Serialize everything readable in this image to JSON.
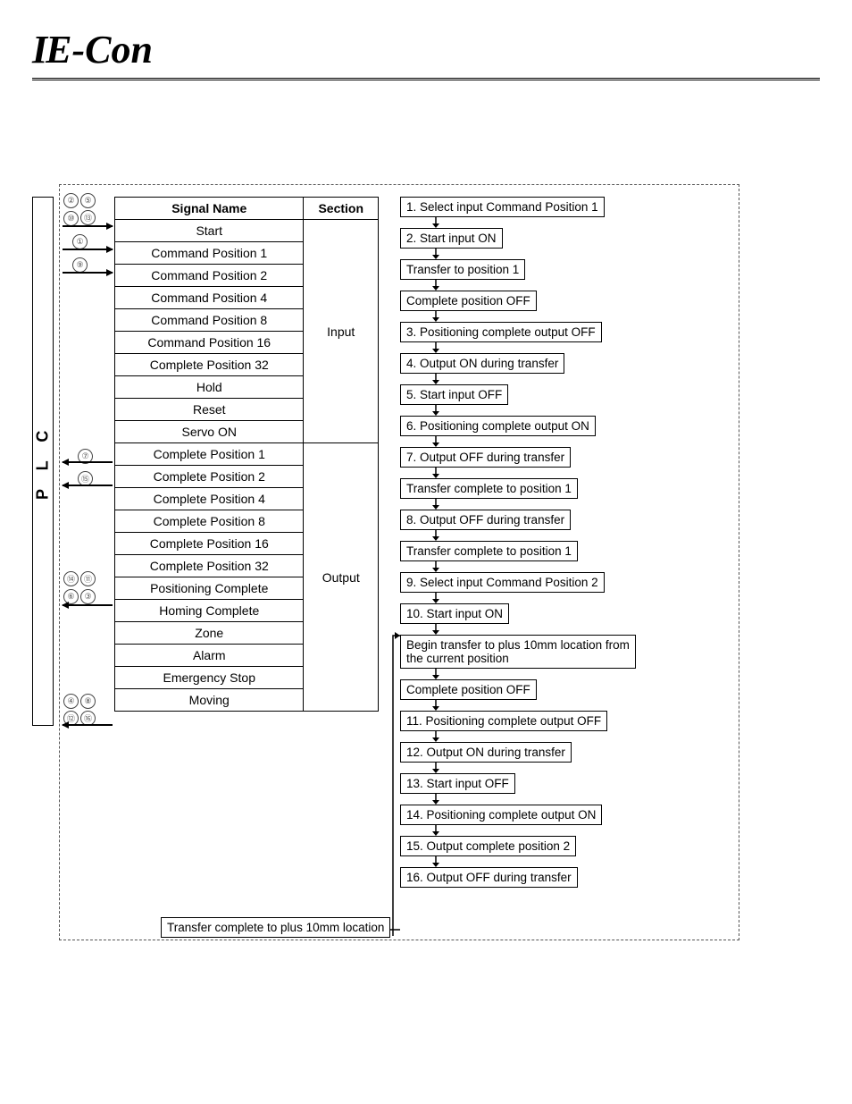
{
  "brand": {
    "prefix": "IE",
    "suffix": "-Con"
  },
  "plc_label": "P L C",
  "table": {
    "headers": {
      "signal": "Signal Name",
      "section": "Section"
    },
    "input_section": "Input",
    "output_section": "Output",
    "input_rows": [
      "Start",
      "Command Position 1",
      "Command Position 2",
      "Command Position 4",
      "Command Position 8",
      "Command Position 16",
      "Complete Position 32",
      "Hold",
      "Reset",
      "Servo ON"
    ],
    "output_rows": [
      "Complete Position 1",
      "Complete Position 2",
      "Complete Position 4",
      "Complete Position 8",
      "Complete Position 16",
      "Complete Position 32",
      "Positioning Complete",
      "Homing Complete",
      "Zone",
      "Alarm",
      "Emergency Stop",
      "Moving"
    ]
  },
  "bubble_groups": {
    "g1": [
      "②",
      "⑤",
      "⑩",
      "⑬"
    ],
    "g2": [
      "①"
    ],
    "g3": [
      "⑨"
    ],
    "g4": [
      "⑦"
    ],
    "g5": [
      "⑮"
    ],
    "g6": [
      "⑭",
      "⑪",
      "⑥",
      "③"
    ],
    "g7": [
      "④",
      "⑧",
      "⑫",
      "⑯"
    ]
  },
  "flow": [
    "1. Select input Command Position 1",
    "2. Start input ON",
    "Transfer to position 1",
    "Complete position OFF",
    "3. Positioning complete output OFF",
    "4. Output ON during transfer",
    "5. Start input OFF",
    "6. Positioning complete output ON",
    "7. Output OFF during transfer",
    "Transfer complete to position 1",
    "8. Output OFF during transfer",
    "Transfer complete to position 1",
    "9. Select input Command Position 2",
    "10. Start input ON",
    "Begin transfer to plus 10mm location from the current position",
    "Complete position OFF",
    "11. Positioning complete output OFF",
    "12. Output ON during transfer",
    "13. Start input OFF",
    "14. Positioning complete output ON",
    "15. Output complete position 2",
    "16. Output OFF during transfer"
  ],
  "final_box": "Transfer complete to plus 10mm location"
}
